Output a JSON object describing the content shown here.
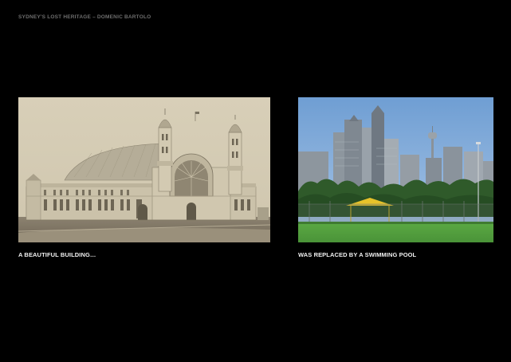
{
  "header": {
    "text": "SYDNEY'S LOST HERITAGE – DOMENIC BARTOLO"
  },
  "panels": [
    {
      "caption": "A BEAUTIFUL BUILDING…",
      "image_description": "sepia photograph of ornate exhibition building with domes and towers"
    },
    {
      "caption": "WAS REPLACED BY A SWIMMING POOL",
      "image_description": "colour photograph of city skyline behind a fenced green lawn with a yellow shade canopy"
    }
  ],
  "colors": {
    "background": "#000000",
    "header_text": "#6e6e6e",
    "caption_text": "#f2f2f2",
    "sepia": "#c9c0a8",
    "sky": "#7fa8d6",
    "grass": "#4f9a3c",
    "canopy": "#e6c22a"
  }
}
